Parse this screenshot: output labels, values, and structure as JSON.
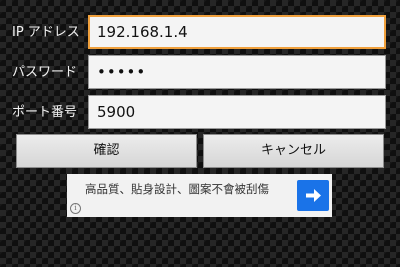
{
  "form": {
    "ip": {
      "label": "IP アドレス",
      "value": "192.168.1.4"
    },
    "password": {
      "label": "パスワード",
      "value": "•••••"
    },
    "port": {
      "label": "ポート番号",
      "value": "5900"
    }
  },
  "buttons": {
    "confirm": "確認",
    "cancel": "キャンセル"
  },
  "ad": {
    "text": "高品質、貼身設計、圖案不會被刮傷",
    "info_glyph": "i"
  },
  "colors": {
    "focus_border": "#f0a03c",
    "ad_button": "#1a73e8"
  },
  "icons": {
    "ad_go": "arrow-right-icon",
    "ad_info": "info-icon"
  }
}
